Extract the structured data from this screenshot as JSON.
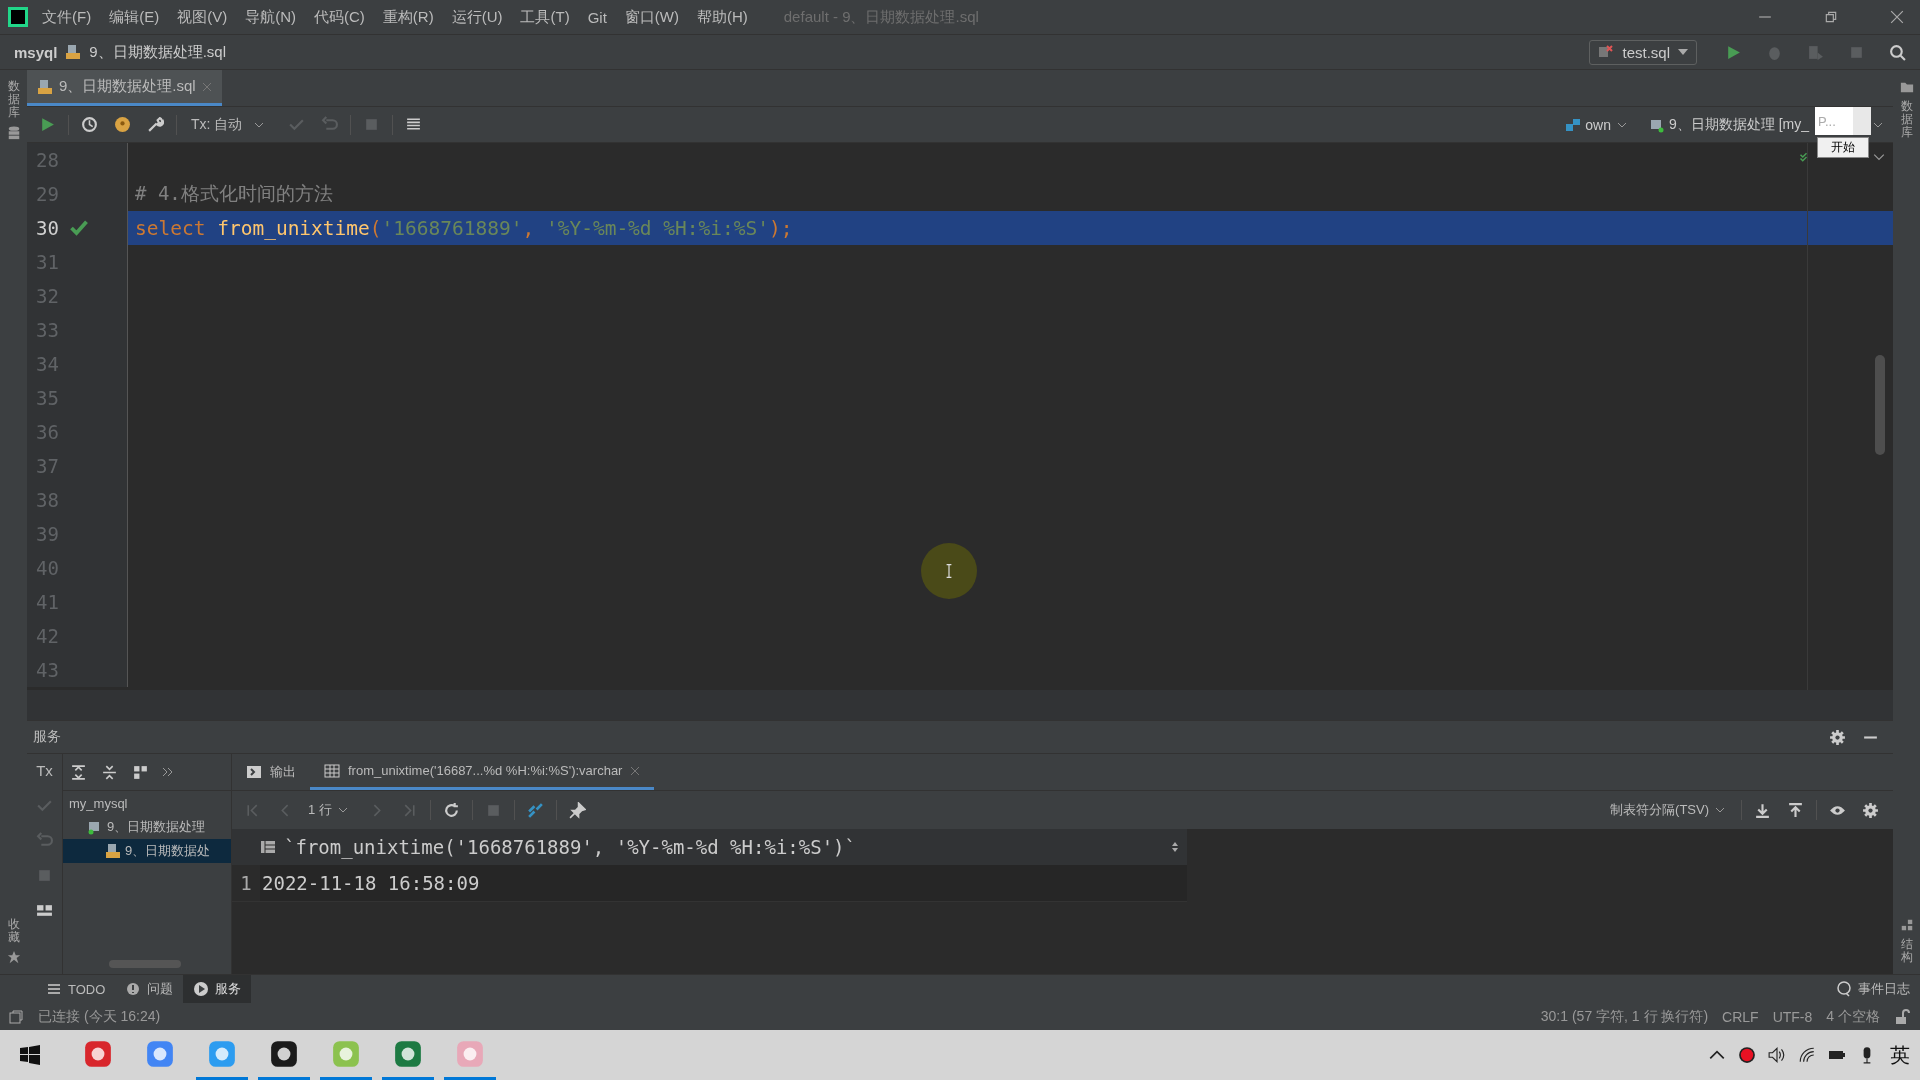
{
  "menu": [
    "文件(F)",
    "编辑(E)",
    "视图(V)",
    "导航(N)",
    "代码(C)",
    "重构(R)",
    "运行(U)",
    "工具(T)",
    "Git",
    "窗口(W)",
    "帮助(H)"
  ],
  "window_title": "default - 9、日期数据处理.sql",
  "breadcrumb": {
    "project": "msyql",
    "file": "9、日期数据处理.sql"
  },
  "run_config": "test.sql",
  "left_strip": {
    "top": "数据库",
    "bottom": "收藏"
  },
  "right_strip": {
    "top": "数据库",
    "bottom": "结构"
  },
  "editor_tabs": [
    {
      "label": "9、日期数据处理.sql",
      "selected": true
    }
  ],
  "editor_toolbar": {
    "tx_mode": "Tx: 自动",
    "schema": "own",
    "session": "9、日期数据处理 [my_"
  },
  "overlay": {
    "field": "P...",
    "button": "开始"
  },
  "editor": {
    "lines": [
      {
        "number": "28",
        "kind": "blank",
        "selected": false
      },
      {
        "number": "29",
        "kind": "comment",
        "selected": false,
        "text": "# 4.格式化时间的方法"
      },
      {
        "number": "30",
        "kind": "code",
        "selected": true,
        "executed": true,
        "tokens": [
          {
            "kind": "keyword",
            "text": "select"
          },
          {
            "kind": "function",
            "text": "from_unixtime"
          },
          {
            "kind": "punct",
            "text": "("
          },
          {
            "kind": "string",
            "text": "'1668761889'"
          },
          {
            "kind": "punct",
            "text": ", "
          },
          {
            "kind": "string",
            "text": "'%Y-%m-%d %H:%i:%S'"
          },
          {
            "kind": "punct",
            "text": ");"
          }
        ]
      },
      {
        "number": "31",
        "kind": "blank",
        "selected": false
      },
      {
        "number": "32",
        "kind": "blank",
        "selected": false
      },
      {
        "number": "33",
        "kind": "blank",
        "selected": false
      },
      {
        "number": "34",
        "kind": "blank",
        "selected": false
      },
      {
        "number": "35",
        "kind": "blank",
        "selected": false
      },
      {
        "number": "36",
        "kind": "blank",
        "selected": false
      },
      {
        "number": "37",
        "kind": "blank",
        "selected": false
      },
      {
        "number": "38",
        "kind": "blank",
        "selected": false
      },
      {
        "number": "39",
        "kind": "blank",
        "selected": false
      },
      {
        "number": "40",
        "kind": "blank",
        "selected": false
      },
      {
        "number": "41",
        "kind": "blank",
        "selected": false
      },
      {
        "number": "42",
        "kind": "blank",
        "selected": false
      },
      {
        "number": "43",
        "kind": "blank",
        "selected": false
      }
    ]
  },
  "services": {
    "title": "服务",
    "tx_label": "Tx",
    "tree": [
      {
        "label": "my_mysql",
        "selected": false,
        "children": [
          {
            "label": "9、日期数据处理",
            "kind": "database",
            "selected": false,
            "children": [
              {
                "label": "9、日期数据处",
                "kind": "file",
                "selected": true
              }
            ]
          }
        ]
      }
    ],
    "tabs": [
      {
        "label": "输出",
        "kind": "output",
        "selected": false
      },
      {
        "label": "from_unixtime('16687...%d %H:%i:%S'):varchar",
        "kind": "table",
        "selected": true
      }
    ],
    "row_count": "1 行",
    "export_format": "制表符分隔(TSV)",
    "grid": {
      "column": "`from_unixtime('1668761889', '%Y-%m-%d %H:%i:%S')`",
      "rows": [
        {
          "number": "1",
          "cells": [
            "2022-11-18 16:58:09"
          ]
        }
      ]
    }
  },
  "bottom_tabs": [
    {
      "label": "TODO",
      "kind": "list",
      "selected": false
    },
    {
      "label": "问题",
      "kind": "info",
      "selected": false
    },
    {
      "label": "服务",
      "kind": "play",
      "selected": true
    }
  ],
  "event_log": "事件日志",
  "status_bar": {
    "message": "已连接 (今天 16:24)",
    "position": "30:1 (57 字符, 1 行 换行符)",
    "line_ending": "CRLF",
    "encoding": "UTF-8",
    "indent": "4 个空格"
  },
  "taskbar": {
    "apps": [
      {
        "kind": "foxit",
        "active": false
      },
      {
        "kind": "chrome",
        "active": false
      },
      {
        "kind": "qq",
        "active": true
      },
      {
        "kind": "datagrip",
        "active": true
      },
      {
        "kind": "notepad",
        "active": true
      },
      {
        "kind": "excel",
        "active": true
      },
      {
        "kind": "paint",
        "active": true
      }
    ],
    "language": "英"
  }
}
